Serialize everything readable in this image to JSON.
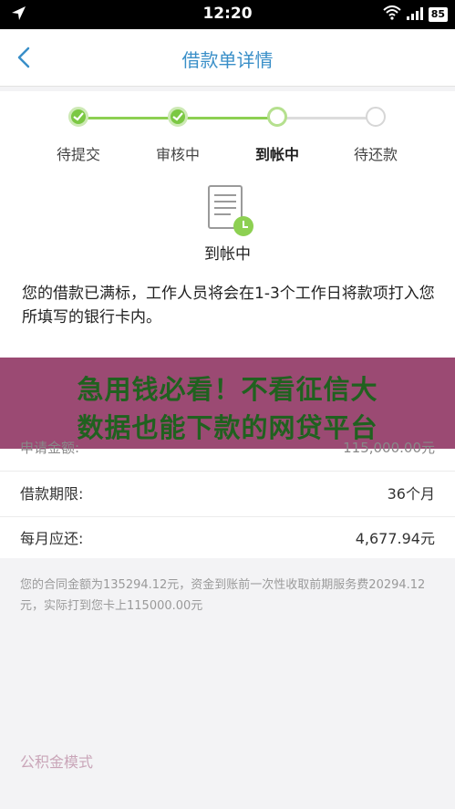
{
  "status_bar": {
    "time": "12:20",
    "battery": "85"
  },
  "nav": {
    "title": "借款单详情"
  },
  "steps": [
    {
      "label": "待提交",
      "state": "done"
    },
    {
      "label": "审核中",
      "state": "done"
    },
    {
      "label": "到帐中",
      "state": "current"
    },
    {
      "label": "待还款",
      "state": "pending"
    }
  ],
  "status": {
    "text": "到帐中"
  },
  "message": "您的借款已满标，工作人员将会在1-3个工作日将款项打入您所填写的银行卡内。",
  "banner": {
    "line1": "急用钱必看！不看征信大",
    "line2": "数据也能下款的网贷平台"
  },
  "section": {
    "title": "公积金模式"
  },
  "details": [
    {
      "key": "申请金额:",
      "value": "115,000.00元"
    },
    {
      "key": "借款期限:",
      "value": "36个月"
    },
    {
      "key": "每月应还:",
      "value": "4,677.94元"
    }
  ],
  "note": "您的合同金额为135294.12元，资金到账前一次性收取前期服务费20294.12元，实际打到您卡上115000.00元",
  "colors": {
    "accent": "#3a8fc8",
    "step_done": "#7bc843",
    "banner_bg": "#9b4a73",
    "banner_text": "#20611f"
  }
}
